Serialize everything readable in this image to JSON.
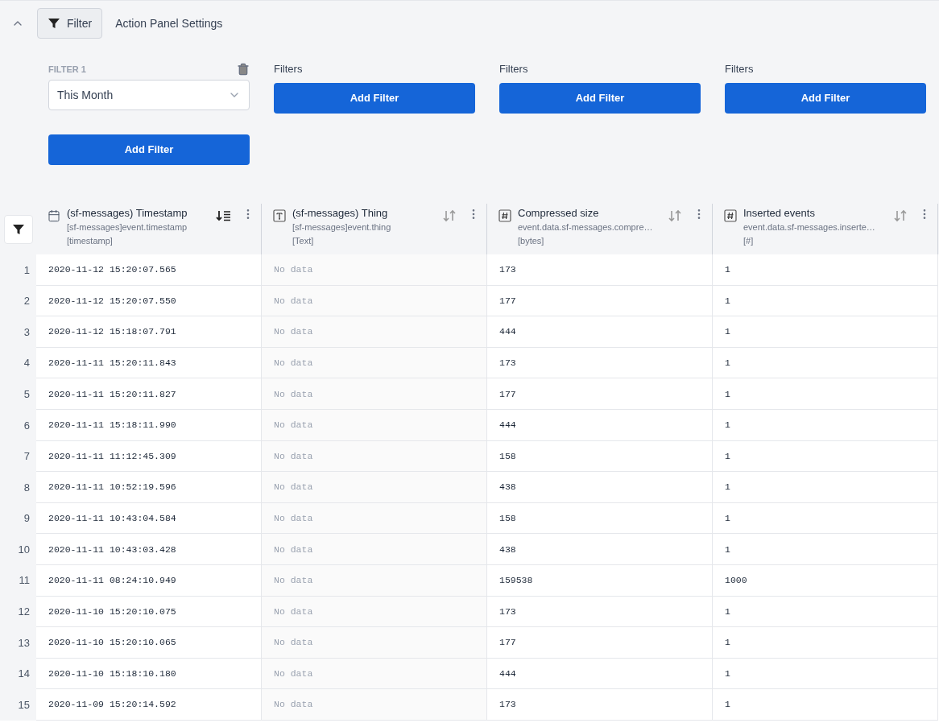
{
  "toolbar": {
    "filter_button": "Filter",
    "settings_link": "Action Panel Settings",
    "expanded": true
  },
  "filter_groups": [
    {
      "kind": "select",
      "label": "FILTER 1",
      "value": "This Month",
      "button": "Add Filter"
    },
    {
      "kind": "empty",
      "label": "Filters",
      "button": "Add Filter"
    },
    {
      "kind": "empty",
      "label": "Filters",
      "button": "Add Filter"
    },
    {
      "kind": "empty",
      "label": "Filters",
      "button": "Add Filter"
    }
  ],
  "table": {
    "columns": [
      {
        "kind": "date",
        "title": "(sf-messages) Timestamp",
        "path": "[sf-messages]event.timestamp",
        "unit": "[timestamp]",
        "sorted": true
      },
      {
        "kind": "text",
        "title": "(sf-messages) Thing",
        "path": "[sf-messages]event.thing",
        "unit": "[Text]",
        "sorted": false
      },
      {
        "kind": "number",
        "title": "Compressed size",
        "path": "event.data.sf-messages.compre…",
        "unit": "[bytes]",
        "sorted": false
      },
      {
        "kind": "number",
        "title": "Inserted events",
        "path": "event.data.sf-messages.inserte…",
        "unit": "[#]",
        "sorted": false
      }
    ],
    "rows": [
      {
        "number": "1",
        "cells": [
          "2020-11-12 15:20:07.565",
          "No data",
          "173",
          "1"
        ],
        "empty": [
          false,
          true,
          false,
          false
        ]
      },
      {
        "number": "2",
        "cells": [
          "2020-11-12 15:20:07.550",
          "No data",
          "177",
          "1"
        ],
        "empty": [
          false,
          true,
          false,
          false
        ]
      },
      {
        "number": "3",
        "cells": [
          "2020-11-12 15:18:07.791",
          "No data",
          "444",
          "1"
        ],
        "empty": [
          false,
          true,
          false,
          false
        ]
      },
      {
        "number": "4",
        "cells": [
          "2020-11-11 15:20:11.843",
          "No data",
          "173",
          "1"
        ],
        "empty": [
          false,
          true,
          false,
          false
        ]
      },
      {
        "number": "5",
        "cells": [
          "2020-11-11 15:20:11.827",
          "No data",
          "177",
          "1"
        ],
        "empty": [
          false,
          true,
          false,
          false
        ]
      },
      {
        "number": "6",
        "cells": [
          "2020-11-11 15:18:11.990",
          "No data",
          "444",
          "1"
        ],
        "empty": [
          false,
          true,
          false,
          false
        ]
      },
      {
        "number": "7",
        "cells": [
          "2020-11-11 11:12:45.309",
          "No data",
          "158",
          "1"
        ],
        "empty": [
          false,
          true,
          false,
          false
        ]
      },
      {
        "number": "8",
        "cells": [
          "2020-11-11 10:52:19.596",
          "No data",
          "438",
          "1"
        ],
        "empty": [
          false,
          true,
          false,
          false
        ]
      },
      {
        "number": "9",
        "cells": [
          "2020-11-11 10:43:04.584",
          "No data",
          "158",
          "1"
        ],
        "empty": [
          false,
          true,
          false,
          false
        ]
      },
      {
        "number": "10",
        "cells": [
          "2020-11-11 10:43:03.428",
          "No data",
          "438",
          "1"
        ],
        "empty": [
          false,
          true,
          false,
          false
        ]
      },
      {
        "number": "11",
        "cells": [
          "2020-11-11 08:24:10.949",
          "No data",
          "159538",
          "1000"
        ],
        "empty": [
          false,
          true,
          false,
          false
        ]
      },
      {
        "number": "12",
        "cells": [
          "2020-11-10 15:20:10.075",
          "No data",
          "173",
          "1"
        ],
        "empty": [
          false,
          true,
          false,
          false
        ]
      },
      {
        "number": "13",
        "cells": [
          "2020-11-10 15:20:10.065",
          "No data",
          "177",
          "1"
        ],
        "empty": [
          false,
          true,
          false,
          false
        ]
      },
      {
        "number": "14",
        "cells": [
          "2020-11-10 15:18:10.180",
          "No data",
          "444",
          "1"
        ],
        "empty": [
          false,
          true,
          false,
          false
        ]
      },
      {
        "number": "15",
        "cells": [
          "2020-11-09 15:20:14.592",
          "No data",
          "173",
          "1"
        ],
        "empty": [
          false,
          true,
          false,
          false
        ]
      }
    ]
  }
}
